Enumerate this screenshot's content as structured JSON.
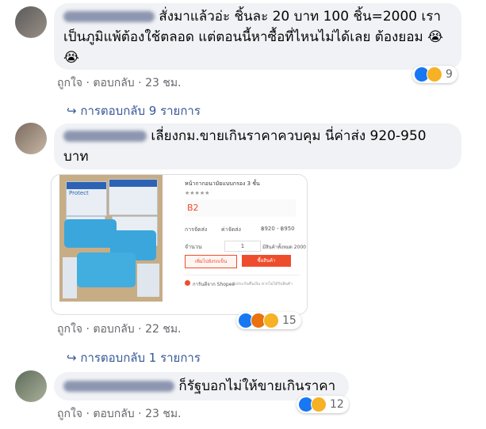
{
  "colors": {
    "bubble": "#f0f2f5",
    "link": "#385898",
    "meta": "#65676b",
    "like": "#1877f2",
    "shopee": "#ee4d2d"
  },
  "comments": [
    {
      "text": "สั่งมาแล้วอ่ะ ชิ้นละ 20 บาท 100 ชิ้น=2000 เราเป็นภูมิแพ้ต้องใช้ตลอด แต่ตอนนี้หาซื้อที่ไหนไม่ได้เลย ต้องยอม",
      "emoji": "😭😭",
      "like": "ถูกใจ",
      "reply": "ตอบกลับ",
      "time": "23 ชม.",
      "reaction_icons": [
        "like-icon",
        "sad-icon"
      ],
      "reaction_count": "9",
      "replies": "การตอบกลับ 9 รายการ"
    },
    {
      "text": "เลี่ยงกม.ขายเกินราคาควบคุม นี่ค่าส่ง 920-950 บาท",
      "like": "ถูกใจ",
      "reply": "ตอบกลับ",
      "time": "22 ชม.",
      "reaction_icons": [
        "like-icon",
        "angry-icon",
        "wow-icon"
      ],
      "reaction_count": "15",
      "replies": "การตอบกลับ 1 รายการ",
      "attachment": {
        "title": "หน้ากากอนามัยแบบกรอง 3 ชั้น",
        "variant": "B2",
        "shipping_label": "การจัดส่ง",
        "shipping_value": "ค่าจัดส่ง",
        "shipping_price": "฿920 - ฿950",
        "qty_label": "จำนวน",
        "qty_value": "1",
        "stock": "มีสินค้าทั้งหมด 2000 ชิ้น",
        "add_to_cart": "เพิ่มไปยังรถเข็น",
        "buy_now": "ซื้อสินค้า",
        "guarantee": "การันตีจาก Shopee",
        "guarantee_desc": "รับประกันคืนเงิน หากไม่ได้รับสินค้า",
        "box_brand": "Protect"
      }
    },
    {
      "text": "ก็รัฐบอกไม่ให้ขายเกินราคา",
      "like": "ถูกใจ",
      "reply": "ตอบกลับ",
      "time": "23 ชม.",
      "reaction_icons": [
        "like-icon",
        "laugh-icon"
      ],
      "reaction_count": "12"
    }
  ]
}
